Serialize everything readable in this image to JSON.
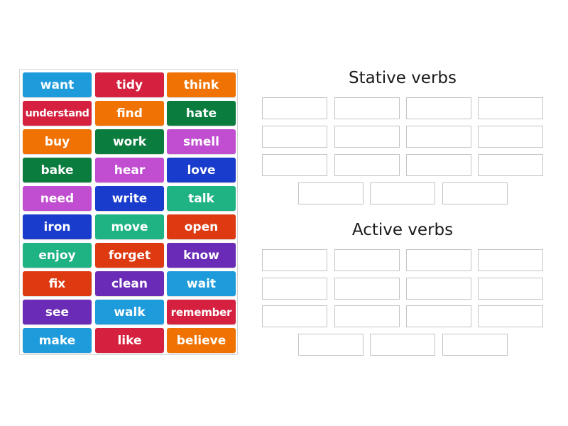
{
  "colors": {
    "lightblue": "#1e9bdb",
    "crimson": "#d5213f",
    "orange": "#f07202",
    "darkgreen": "#0a7d3e",
    "magenta": "#c14ed1",
    "navy": "#1a3ccc",
    "teal": "#1fb283",
    "redorange": "#dd3a12",
    "purple": "#6a2bb6"
  },
  "tiles": [
    {
      "label": "want",
      "color": "lightblue"
    },
    {
      "label": "tidy",
      "color": "crimson"
    },
    {
      "label": "think",
      "color": "orange"
    },
    {
      "label": "understand",
      "color": "crimson"
    },
    {
      "label": "find",
      "color": "orange"
    },
    {
      "label": "hate",
      "color": "darkgreen"
    },
    {
      "label": "buy",
      "color": "orange"
    },
    {
      "label": "work",
      "color": "darkgreen"
    },
    {
      "label": "smell",
      "color": "magenta"
    },
    {
      "label": "bake",
      "color": "darkgreen"
    },
    {
      "label": "hear",
      "color": "magenta"
    },
    {
      "label": "love",
      "color": "navy"
    },
    {
      "label": "need",
      "color": "magenta"
    },
    {
      "label": "write",
      "color": "navy"
    },
    {
      "label": "talk",
      "color": "teal"
    },
    {
      "label": "iron",
      "color": "navy"
    },
    {
      "label": "move",
      "color": "teal"
    },
    {
      "label": "open",
      "color": "redorange"
    },
    {
      "label": "enjoy",
      "color": "teal"
    },
    {
      "label": "forget",
      "color": "redorange"
    },
    {
      "label": "know",
      "color": "purple"
    },
    {
      "label": "fix",
      "color": "redorange"
    },
    {
      "label": "clean",
      "color": "purple"
    },
    {
      "label": "wait",
      "color": "lightblue"
    },
    {
      "label": "see",
      "color": "purple"
    },
    {
      "label": "walk",
      "color": "lightblue"
    },
    {
      "label": "remember",
      "color": "crimson"
    },
    {
      "label": "make",
      "color": "lightblue"
    },
    {
      "label": "like",
      "color": "crimson"
    },
    {
      "label": "believe",
      "color": "orange"
    }
  ],
  "groups": [
    {
      "title": "Stative verbs",
      "slot_count": 15
    },
    {
      "title": "Active verbs",
      "slot_count": 15
    }
  ]
}
